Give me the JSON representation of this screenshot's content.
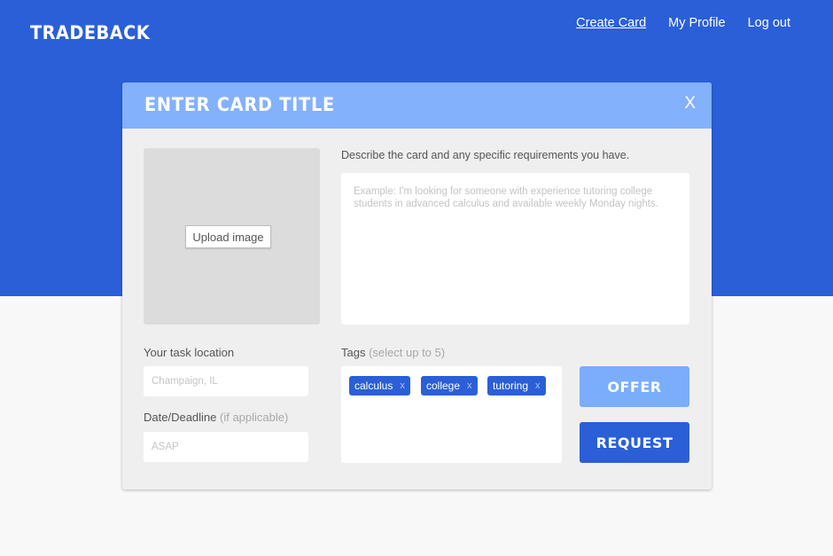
{
  "header": {
    "logo": "TRADEBACK",
    "nav": [
      {
        "label": "Create Card",
        "active": true
      },
      {
        "label": "My Profile",
        "active": false
      },
      {
        "label": "Log out",
        "active": false
      }
    ]
  },
  "modal": {
    "title": "ENTER CARD TITLE",
    "close_label": "X",
    "upload_label": "Upload image",
    "description_label": "Describe the card and any specific requirements you have.",
    "description_placeholder": "Example: I'm looking for someone with experience tutoring college students in advanced calculus and available weekly Monday nights.",
    "location_label": "Your task location",
    "location_placeholder": "Champaign, IL",
    "date_label": "Date/Deadline",
    "date_hint": "(if applicable)",
    "date_placeholder": "ASAP",
    "tags_label": "Tags",
    "tags_hint": "(select up to 5)",
    "tags": [
      {
        "label": "calculus",
        "remove": "x"
      },
      {
        "label": "college",
        "remove": "x"
      },
      {
        "label": "tutoring",
        "remove": "x"
      }
    ],
    "offer_label": "OFFER",
    "request_label": "REQUEST"
  },
  "colors": {
    "brand_blue": "#2b5fd8",
    "header_light_blue": "#84b1fc",
    "offer_blue": "#7aaefc",
    "modal_bg": "#efefef"
  }
}
